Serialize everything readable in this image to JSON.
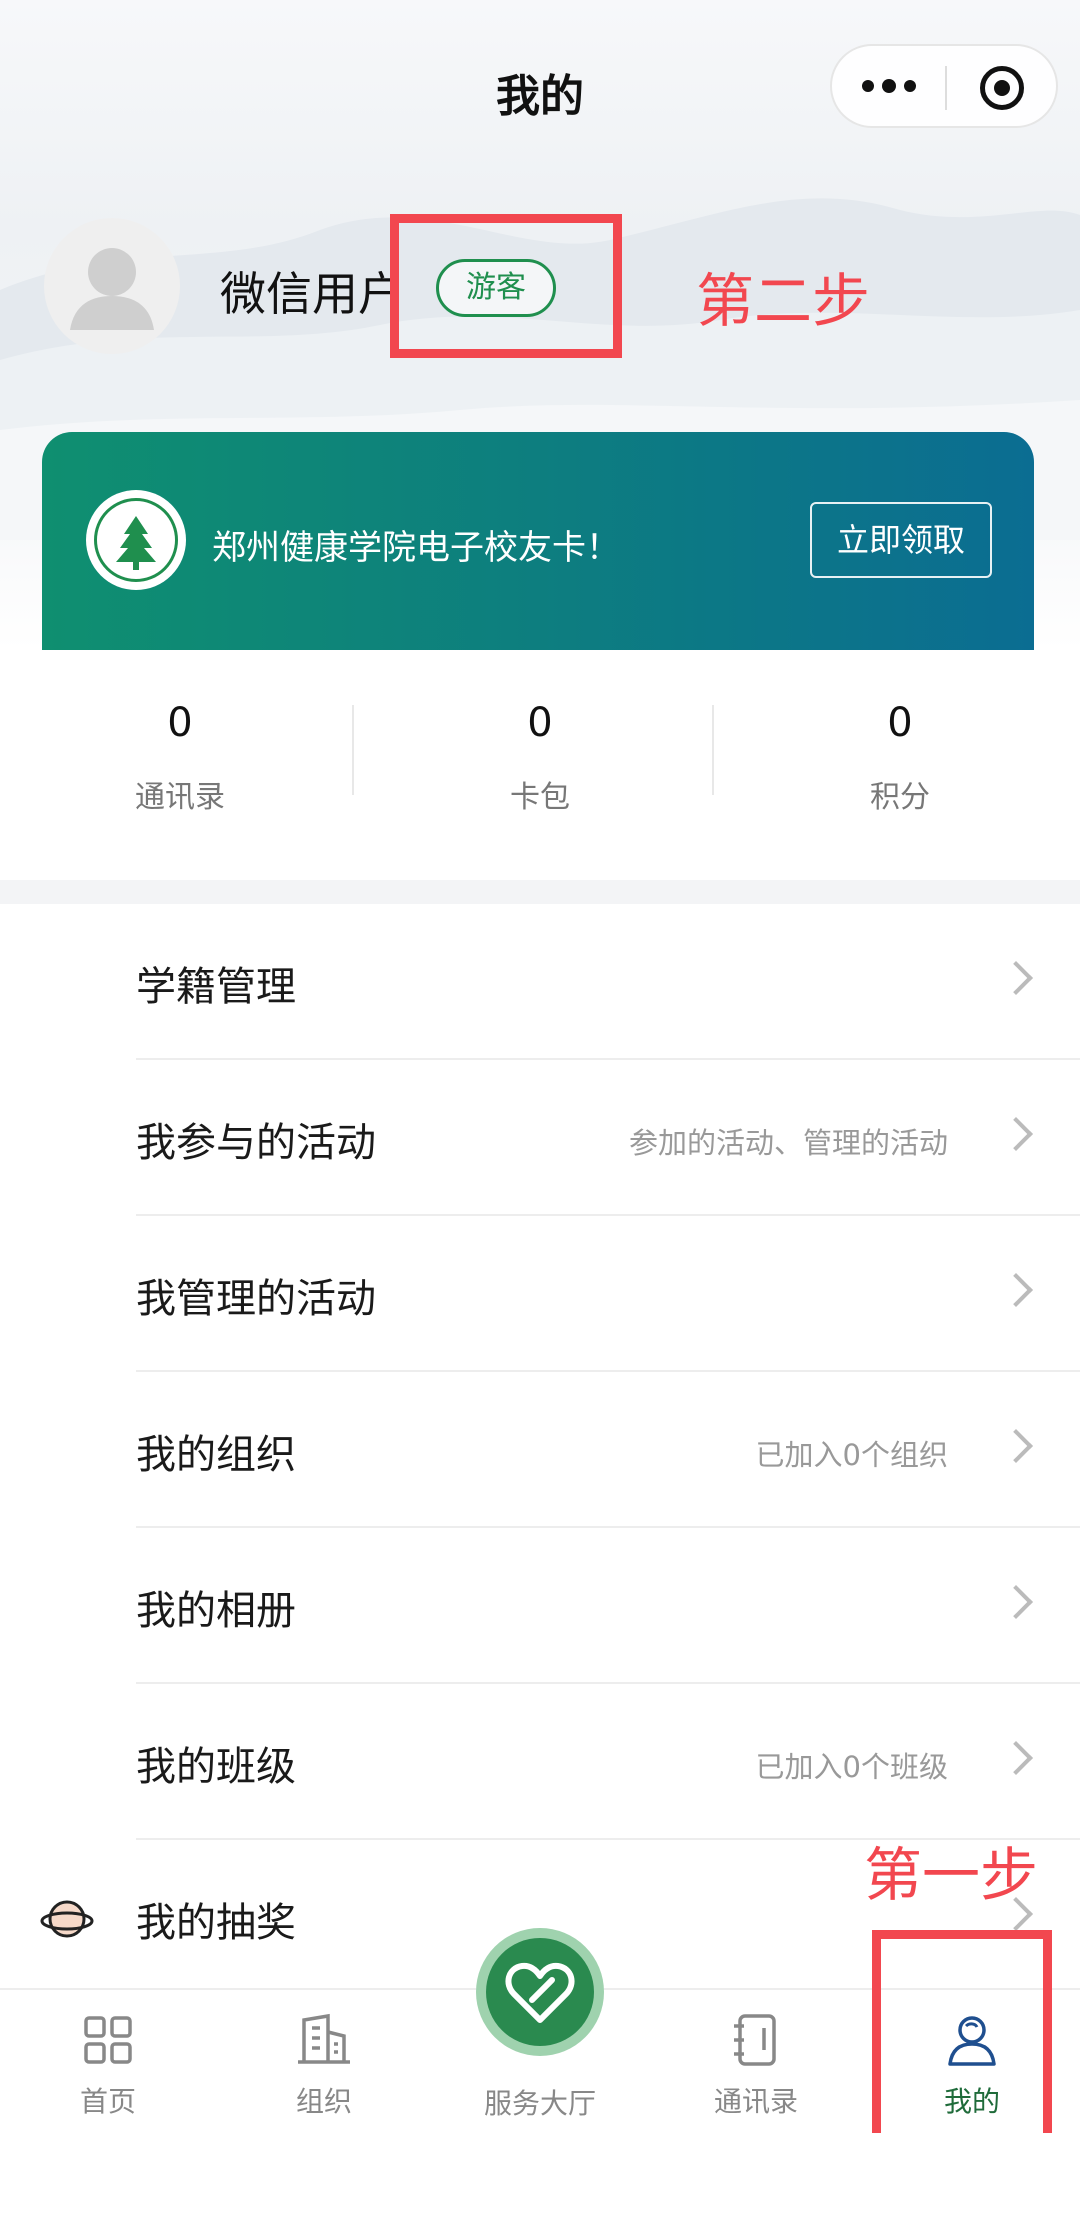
{
  "header": {
    "title": "我的"
  },
  "profile": {
    "username": "微信用户",
    "badge": "游客"
  },
  "annotations": {
    "step2": "第二步",
    "step1": "第一步",
    "color": "#f2474f"
  },
  "card": {
    "text": "郑州健康学院电子校友卡！",
    "button": "立即领取"
  },
  "stats": [
    {
      "value": "0",
      "label": "通讯录"
    },
    {
      "value": "0",
      "label": "卡包"
    },
    {
      "value": "0",
      "label": "积分"
    }
  ],
  "menu": [
    {
      "label": "学籍管理",
      "sub": ""
    },
    {
      "label": "我参与的活动",
      "sub": "参加的活动、管理的活动"
    },
    {
      "label": "我管理的活动",
      "sub": ""
    },
    {
      "label": "我的组织",
      "sub": "已加入0个组织"
    },
    {
      "label": "我的相册",
      "sub": ""
    },
    {
      "label": "我的班级",
      "sub": "已加入0个班级"
    },
    {
      "label": "我的抽奖",
      "sub": ""
    }
  ],
  "tabbar": [
    {
      "label": "首页",
      "icon": "grid-icon"
    },
    {
      "label": "组织",
      "icon": "building-icon"
    },
    {
      "label": "服务大厅",
      "icon": "heart-icon"
    },
    {
      "label": "通讯录",
      "icon": "contacts-icon"
    },
    {
      "label": "我的",
      "icon": "user-icon",
      "active": true
    }
  ],
  "colors": {
    "brand_green": "#1f8f4e",
    "card_gradient_start": "#0f8f70",
    "card_gradient_end": "#0b6d92"
  }
}
